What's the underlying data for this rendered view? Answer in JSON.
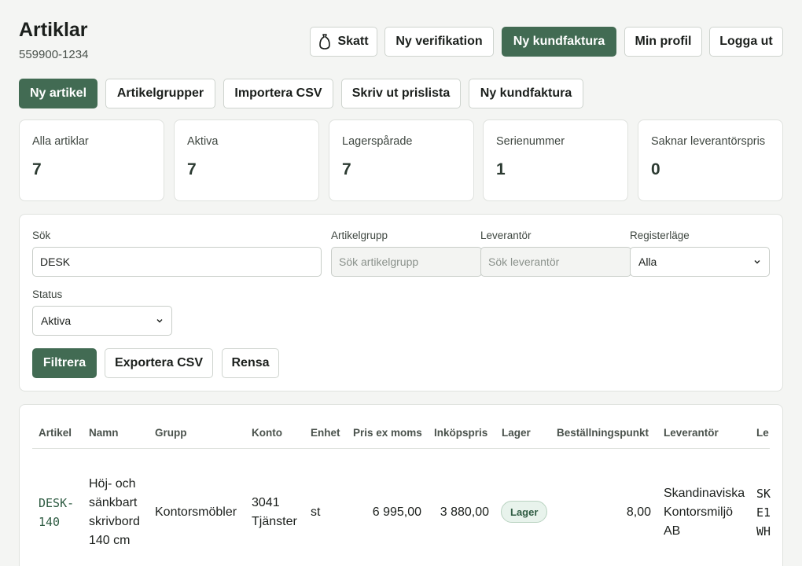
{
  "header": {
    "title": "Artiklar",
    "org_number": "559900-1234",
    "actions": {
      "tax_label": "Skatt",
      "new_verification_label": "Ny verifikation",
      "new_invoice_label": "Ny kundfaktura",
      "profile_label": "Min profil",
      "logout_label": "Logga ut"
    }
  },
  "toolbar": {
    "new_article_label": "Ny artikel",
    "groups_label": "Artikelgrupper",
    "import_label": "Importera CSV",
    "print_label": "Skriv ut prislista",
    "new_invoice_label": "Ny kundfaktura"
  },
  "stats": [
    {
      "label": "Alla artiklar",
      "value": "7"
    },
    {
      "label": "Aktiva",
      "value": "7"
    },
    {
      "label": "Lagerspårade",
      "value": "7"
    },
    {
      "label": "Serienummer",
      "value": "1"
    },
    {
      "label": "Saknar leverantörspris",
      "value": "0"
    }
  ],
  "filters": {
    "search_label": "Sök",
    "search_value": "DESK",
    "group_label": "Artikelgrupp",
    "group_placeholder": "Sök artikelgrupp",
    "supplier_label": "Leverantör",
    "supplier_placeholder": "Sök leverantör",
    "mode_label": "Registerläge",
    "mode_value": "Alla",
    "status_label": "Status",
    "status_value": "Aktiva",
    "filter_label": "Filtrera",
    "export_label": "Exportera CSV",
    "clear_label": "Rensa"
  },
  "table": {
    "columns": [
      "Artikel",
      "Namn",
      "Grupp",
      "Konto",
      "Enhet",
      "Pris ex moms",
      "Inköpspris",
      "Lager",
      "Beställningspunkt",
      "Leverantör",
      "Le"
    ],
    "rows": [
      {
        "article_line1": "DESK-",
        "article_line2": "140",
        "name_lines": [
          "Höj- och",
          "sänkbart",
          "skrivbord",
          "140 cm"
        ],
        "group": "Kontorsmöbler",
        "account_line1": "3041",
        "account_line2": "Tjänster",
        "unit": "st",
        "price": "6 995,00",
        "purchase_price": "3 880,00",
        "stock_badge": "Lager",
        "reorder_point": "8,00",
        "supplier_lines": [
          "Skandinaviska",
          "Kontorsmiljö",
          "AB"
        ],
        "supplier_ref_lines": [
          "SK",
          "E1",
          "WH"
        ]
      }
    ]
  },
  "colors": {
    "accent": "#426b53",
    "background": "#f4f5f3",
    "badge_bg": "#e8f3ec"
  }
}
